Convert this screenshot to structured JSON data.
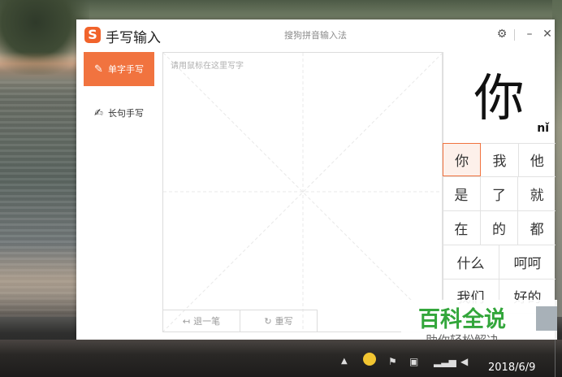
{
  "window": {
    "title": "手写输入",
    "subtitle": "搜狗拼音输入法",
    "logo_text": "S",
    "accent_color": "#f1733f"
  },
  "titlebar_icons": [
    "gear-icon",
    "minimize-icon",
    "close-icon"
  ],
  "sidebar": {
    "items": [
      {
        "label": "单字手写",
        "icon": "pen-square-icon",
        "active": true
      },
      {
        "label": "长句手写",
        "icon": "pen-lines-icon",
        "active": false
      }
    ]
  },
  "pad": {
    "placeholder": "请用鼠标在这里写字",
    "undo_label": "退一笔",
    "rewrite_label": "重写"
  },
  "preview": {
    "character": "你",
    "pinyin": "nǐ"
  },
  "candidates": [
    [
      "你",
      "我",
      "他"
    ],
    [
      "是",
      "了",
      "就"
    ],
    [
      "在",
      "的",
      "都"
    ],
    [
      "什么",
      "呵呵"
    ],
    [
      "我们",
      "好的"
    ]
  ],
  "selected_candidate": "你",
  "watermark": {
    "title": "百科全说",
    "subtitle": "助你轻松解决"
  },
  "taskbar": {
    "clock_date": "2018/6/9",
    "tray_icons": [
      "show-hidden-icon",
      "qq-icon",
      "flag-icon",
      "network-icon",
      "signal-icon",
      "volume-icon"
    ]
  }
}
